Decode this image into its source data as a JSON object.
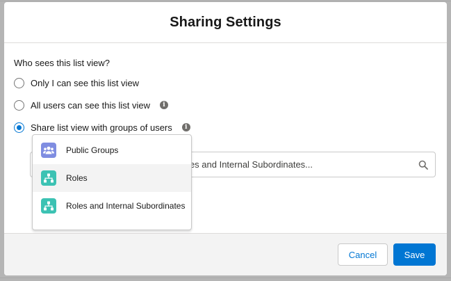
{
  "modal": {
    "title": "Sharing Settings"
  },
  "visibility": {
    "question": "Who sees this list view?",
    "options": [
      {
        "label": "Only I can see this list view",
        "selected": false,
        "has_info": false
      },
      {
        "label": "All users can see this list view",
        "selected": false,
        "has_info": true
      },
      {
        "label": "Share list view with groups of users",
        "selected": true,
        "has_info": true
      }
    ]
  },
  "share_search": {
    "value": "",
    "placeholder": "Search Public Groups, Roles, and Roles and Internal Subordinates...",
    "icon": "search-icon"
  },
  "share_type_dropdown": {
    "items": [
      {
        "label": "Public Groups",
        "icon": "public-groups-icon",
        "color": "#7f8de1"
      },
      {
        "label": "Roles",
        "icon": "roles-icon",
        "color": "#3cc2b3",
        "hovered": true
      },
      {
        "label": "Roles and Internal Subordinates",
        "icon": "roles-subordinates-icon",
        "color": "#3cc2b3"
      }
    ]
  },
  "footer": {
    "cancel_label": "Cancel",
    "save_label": "Save"
  },
  "colors": {
    "brand": "#0176d3",
    "groups_icon": "#7f8de1",
    "roles_icon": "#3cc2b3"
  }
}
